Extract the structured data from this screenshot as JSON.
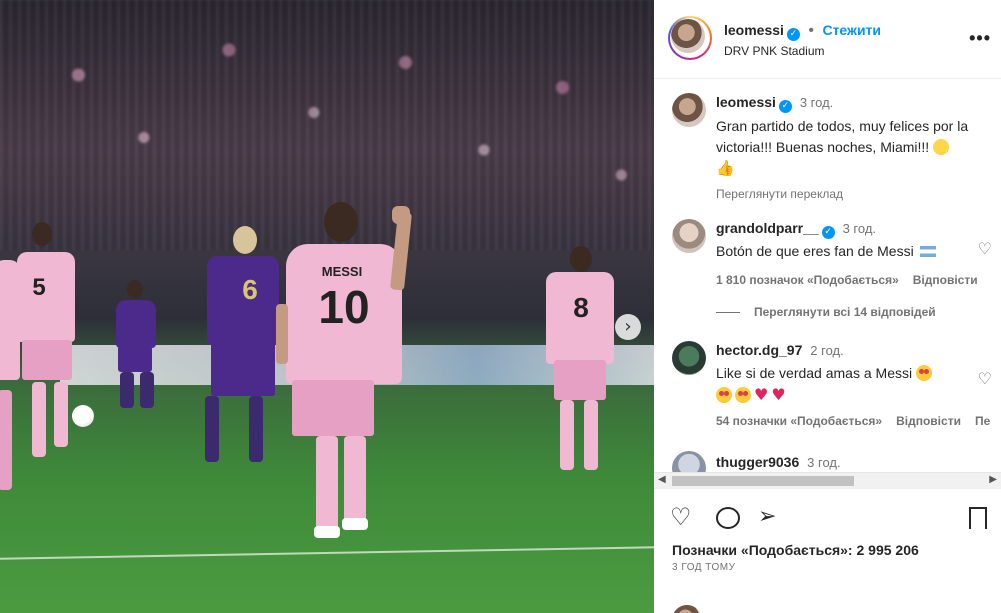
{
  "post": {
    "author": "leomessi",
    "follow_label": "Стежити",
    "location": "DRV PNK Stadium",
    "caption_time": "3 год.",
    "caption": "Gran partido de todos, muy felices por la victoria!!! Buenas noches, Miami!!!",
    "translate_label": "Переглянути переклад",
    "likes_label": "Позначки «Подобається»: 2 995 206",
    "time_ago": "3 ГОД ТОМУ",
    "more_icon": "more-options-icon"
  },
  "photo": {
    "player_name": "MESSI",
    "player_number": "10",
    "jersey_6": "6",
    "jersey_8": "8",
    "jersey_5": "5"
  },
  "comments": [
    {
      "user": "grandoldparr__",
      "time": "3 год.",
      "text": "Botón de que eres fan de Messi",
      "likes": "1 810 позначок «Подобається»",
      "reply": "Відповісти"
    },
    {
      "user": "hector.dg_97",
      "time": "2 год.",
      "text": "Like si de verdad amas a Messi",
      "likes": "54 позначки «Подобається»",
      "reply": "Відповісти",
      "extra": "Пе"
    },
    {
      "user": "thugger9036",
      "time": "3 год."
    }
  ],
  "view_replies": "Переглянути всі 14 відповідей",
  "colors": {
    "accent": "#0095f6",
    "heart_red": "#e0245e",
    "inter_pink": "#f1b8d3"
  }
}
